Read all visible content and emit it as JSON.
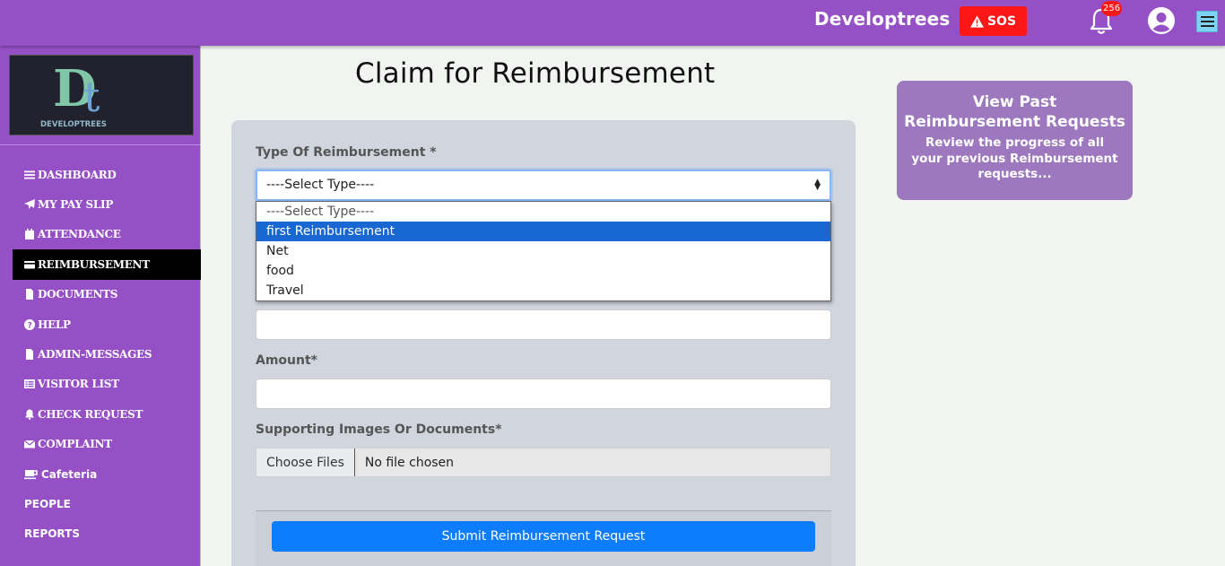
{
  "header": {
    "brand": "Developtrees",
    "sos_label": "SOS",
    "notification_count": "256"
  },
  "sidebar": {
    "logo_text": "DEVELOPTREES",
    "items": [
      {
        "label": "DASHBOARD",
        "icon": "bars-icon"
      },
      {
        "label": "MY PAY SLIP",
        "icon": "paper-plane-icon"
      },
      {
        "label": "ATTENDANCE",
        "icon": "calendar-icon"
      },
      {
        "label": "REIMBURSEMENT",
        "icon": "credit-card-icon",
        "active": true
      },
      {
        "label": "DOCUMENTS",
        "icon": "file-icon"
      },
      {
        "label": "HELP",
        "icon": "question-circle-icon"
      },
      {
        "label": "ADMIN-MESSAGES",
        "icon": "file-icon"
      },
      {
        "label": "VISITOR LIST",
        "icon": "list-icon"
      },
      {
        "label": "CHECK REQUEST",
        "icon": "bell-icon"
      },
      {
        "label": "COMPLAINT",
        "icon": "envelope-icon"
      },
      {
        "label": "Cafeteria",
        "icon": "coffee-icon"
      },
      {
        "label": "PEOPLE",
        "icon": ""
      },
      {
        "label": "REPORTS",
        "icon": ""
      }
    ]
  },
  "main": {
    "title": "Claim for Reimbursement",
    "form": {
      "type_label": "Type Of Reimbursement *",
      "type_selected": "----Select Type----",
      "type_options": [
        "----Select Type----",
        "first Reimbursement",
        "Net",
        "food",
        "Travel"
      ],
      "type_highlighted_index": 1,
      "amount_label": "Amount*",
      "docs_label": "Supporting Images Or Documents*",
      "file_button": "Choose Files",
      "file_status": "No file chosen",
      "submit_label": "Submit Reimbursement Request"
    }
  },
  "info_card": {
    "title": "View Past Reimbursement Requests",
    "description": "Review the progress of all your previous Reimbursement requests..."
  },
  "colors": {
    "primary_purple": "#9650c6",
    "sos_red": "#ff1616",
    "submit_blue": "#0d7cfd",
    "highlight_blue": "#1967d2",
    "info_card": "#9d78be"
  }
}
